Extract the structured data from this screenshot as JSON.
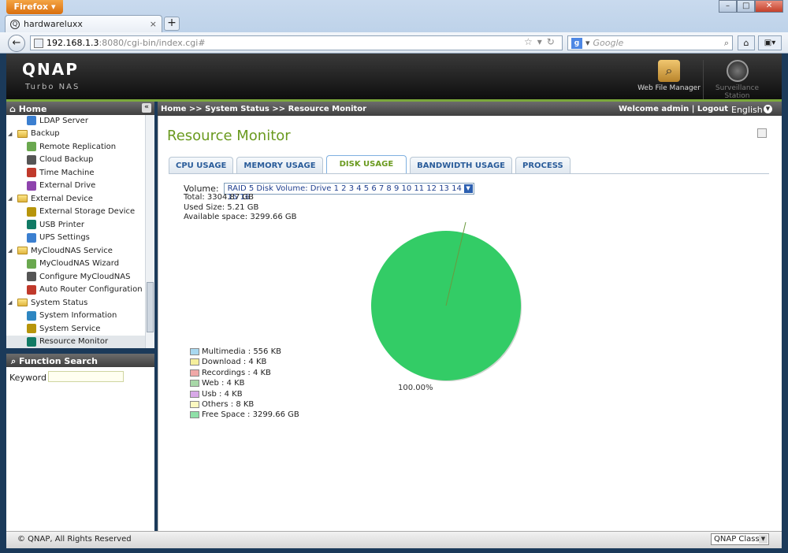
{
  "browser": {
    "app_button": "Firefox",
    "tab_title": "hardwareluxx",
    "url_host": "192.168.1.3",
    "url_rest": ":8080/cgi-bin/index.cgi#",
    "search_placeholder": "Google"
  },
  "header": {
    "logo": "QNAP",
    "logo_sub": "Turbo NAS",
    "apps": [
      "Web File Manager",
      "Surveillance Station"
    ]
  },
  "sidebar": {
    "title": "Home",
    "items": [
      {
        "label": "LDAP Server",
        "level": 2
      },
      {
        "label": "Backup",
        "level": 1
      },
      {
        "label": "Remote Replication",
        "level": 2
      },
      {
        "label": "Cloud Backup",
        "level": 2
      },
      {
        "label": "Time Machine",
        "level": 2
      },
      {
        "label": "External Drive",
        "level": 2
      },
      {
        "label": "External Device",
        "level": 1
      },
      {
        "label": "External Storage Device",
        "level": 2
      },
      {
        "label": "USB Printer",
        "level": 2
      },
      {
        "label": "UPS Settings",
        "level": 2
      },
      {
        "label": "MyCloudNAS Service",
        "level": 1
      },
      {
        "label": "MyCloudNAS Wizard",
        "level": 2
      },
      {
        "label": "Configure MyCloudNAS",
        "level": 2
      },
      {
        "label": "Auto Router Configuration",
        "level": 2
      },
      {
        "label": "System Status",
        "level": 1
      },
      {
        "label": "System Information",
        "level": 2
      },
      {
        "label": "System Service",
        "level": 2
      },
      {
        "label": "Resource Monitor",
        "level": 2,
        "selected": true
      }
    ],
    "function_search_title": "Function Search",
    "keyword_label": "Keyword :"
  },
  "topbar": {
    "breadcrumb": "Home >> System Status >> Resource Monitor",
    "welcome": "Welcome admin | Logout",
    "language": "English"
  },
  "main": {
    "title": "Resource Monitor",
    "tabs": [
      "CPU USAGE",
      "MEMORY USAGE",
      "DISK USAGE",
      "BANDWIDTH USAGE",
      "PROCESS"
    ],
    "active_tab": "DISK USAGE",
    "volume_label": "Volume:",
    "volume_value": "RAID 5 Disk Volume: Drive 1 2 3 4 5 6 7 8 9 10 11 12 13 14 15 16",
    "total": "Total: 3304.87 GB",
    "used": "Used Size: 5.21 GB",
    "available": "Available space: 3299.66 GB",
    "pie_label": "100.00%"
  },
  "legend": [
    {
      "label": "Multimedia : 556 KB",
      "color": "#a8d8f0"
    },
    {
      "label": "Download : 4 KB",
      "color": "#f5ef9c"
    },
    {
      "label": "Recordings : 4 KB",
      "color": "#f0a8a8"
    },
    {
      "label": "Web : 4 KB",
      "color": "#a8d8a8"
    },
    {
      "label": "Usb : 4 KB",
      "color": "#d8a8e8"
    },
    {
      "label": "Others : 8 KB",
      "color": "#fbf8c0"
    },
    {
      "label": "Free Space : 3299.66 GB",
      "color": "#8fe0a8"
    }
  ],
  "chart_data": {
    "type": "pie",
    "categories": [
      "Multimedia",
      "Download",
      "Recordings",
      "Web",
      "Usb",
      "Others",
      "Free Space"
    ],
    "values_kb": [
      556,
      4,
      4,
      4,
      4,
      8,
      3459942646
    ],
    "data_labels": [
      "100.00%"
    ],
    "pie_color": "#33cc66"
  },
  "footer": {
    "copyright": "© QNAP, All Rights Reserved",
    "theme": "QNAP Classic"
  }
}
